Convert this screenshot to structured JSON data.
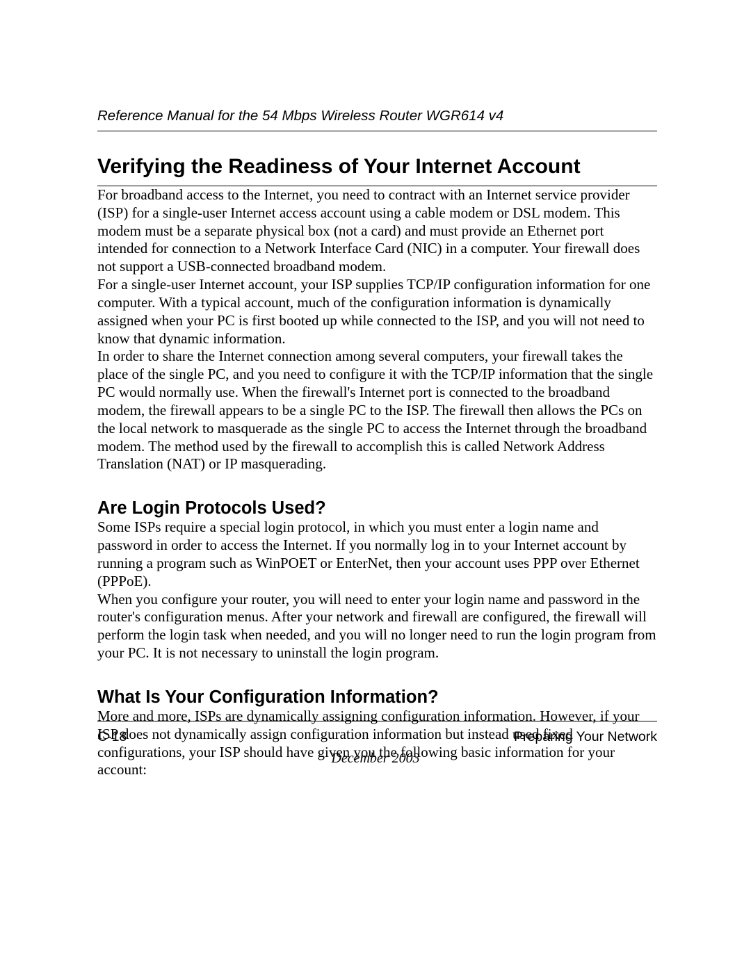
{
  "header": {
    "running_title": "Reference Manual for the 54 Mbps Wireless Router WGR614 v4"
  },
  "main": {
    "h1": "Verifying the Readiness of Your Internet Account",
    "p1": "For broadband access to the Internet, you need to contract with an Internet service provider (ISP) for a single-user Internet access account using a cable modem or DSL modem. This modem must be a separate physical box (not a card) and must provide an Ethernet port intended for connection to a Network Interface Card (NIC) in a computer. Your firewall does not support a USB-connected broadband modem.",
    "p2": "For a single-user Internet account, your ISP supplies TCP/IP configuration information for one computer. With a typical account, much of the configuration information is dynamically assigned when your PC is first booted up while connected to the ISP, and you will not need to know that dynamic information.",
    "p3": "In order to share the Internet connection among several computers, your firewall takes the place of the single PC, and you need to configure it with the TCP/IP information that the single PC would normally use. When the firewall's Internet port is connected to the broadband modem, the firewall appears to be a single PC to the ISP. The firewall then allows the PCs on the local network to masquerade as the single PC to access the Internet through the broadband modem. The method used by the firewall to accomplish this is called Network Address Translation (NAT) or IP masquerading.",
    "h2a": "Are Login Protocols Used?",
    "p4": "Some ISPs require a special login protocol, in which you must enter a login name and password in order to access the Internet. If you normally log in to your Internet account by running a program such as WinPOET or EnterNet, then your account uses PPP over Ethernet (PPPoE).",
    "p5": "When you configure your router, you will need to enter your login name and password in the router's configuration menus. After your network and firewall are configured, the firewall will perform the login task when needed, and you will no longer need to run the login program from your PC. It is not necessary to uninstall the login program.",
    "h2b": "What Is Your Configuration Information?",
    "p6": "More and more, ISPs are dynamically assigning configuration information. However, if your ISP does not dynamically assign configuration information but instead used fixed configurations, your ISP should have given you the following basic information for your account:"
  },
  "footer": {
    "page_number": "C-18",
    "section": "Preparing Your Network",
    "date": "December 2003"
  }
}
